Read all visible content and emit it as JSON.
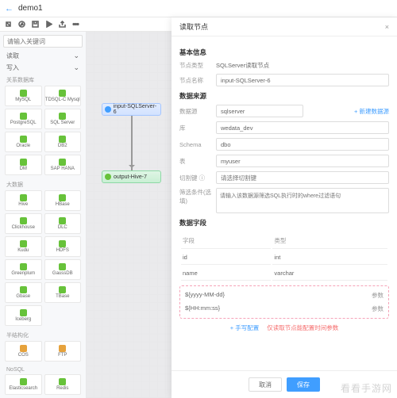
{
  "header": {
    "title": "demo1"
  },
  "search": {
    "placeholder": "请输入关键词"
  },
  "accordion": {
    "read": "读取",
    "write": "写入"
  },
  "groups": [
    {
      "label": "关系数据库",
      "items": [
        {
          "name": "MySQL",
          "c": "g"
        },
        {
          "name": "TDSQL-C Mysql",
          "c": "g"
        },
        {
          "name": "PostgreSQL",
          "c": "g"
        },
        {
          "name": "SQL Server",
          "c": "g"
        },
        {
          "name": "Oracle",
          "c": "g"
        },
        {
          "name": "DB2",
          "c": "g"
        },
        {
          "name": "DM",
          "c": "g"
        },
        {
          "name": "SAP HANA",
          "c": "g"
        }
      ]
    },
    {
      "label": "大数据",
      "items": [
        {
          "name": "Hive",
          "c": "g"
        },
        {
          "name": "HBase",
          "c": "g"
        },
        {
          "name": "Clickhouse",
          "c": "g"
        },
        {
          "name": "DLC",
          "c": "g"
        },
        {
          "name": "Kudu",
          "c": "g"
        },
        {
          "name": "HDFS",
          "c": "g"
        },
        {
          "name": "Greenplum",
          "c": "g"
        },
        {
          "name": "GaussDB",
          "c": "g"
        },
        {
          "name": "Gbase",
          "c": "g"
        },
        {
          "name": "TBase",
          "c": "g"
        },
        {
          "name": "Iceberg",
          "c": "g"
        }
      ]
    },
    {
      "label": "半结构化",
      "items": [
        {
          "name": "COS",
          "c": "o"
        },
        {
          "name": "FTP",
          "c": "o"
        }
      ]
    },
    {
      "label": "NoSQL",
      "items": [
        {
          "name": "Elasticsearch",
          "c": "g"
        },
        {
          "name": "Redis",
          "c": "g"
        }
      ]
    }
  ],
  "canvas": {
    "nodeIn": "input-SQLServer-6",
    "nodeOut": "output-Hive-7"
  },
  "panel": {
    "title": "读取节点",
    "basic": {
      "section": "基本信息",
      "typeLabel": "节点类型",
      "typeValue": "SQLServer读取节点",
      "nameLabel": "节点名称",
      "nameValue": "input-SQLServer-6"
    },
    "source": {
      "section": "数据来源",
      "srcLabel": "数据源",
      "srcValue": "sqlserver",
      "newLink": "+ 新建数据源",
      "dbLabel": "库",
      "dbValue": "wedata_dev",
      "schLabel": "Schema",
      "schValue": "dbo",
      "tblLabel": "表",
      "tblValue": "myuser",
      "splitLabel": "切割键 ⓘ",
      "splitPlaceholder": "请选择切割键",
      "condLabel": "筛选条件(选填)",
      "condPlaceholder": "请输入该数据源筛选SQL执行时的where过滤语句"
    },
    "fields": {
      "section": "数据字段",
      "colField": "字段",
      "colType": "类型",
      "rows": [
        {
          "f": "id",
          "t": "int"
        },
        {
          "f": "name",
          "t": "varchar"
        }
      ],
      "params": [
        {
          "f": "${yyyy-MM-dd}",
          "t": "参数"
        },
        {
          "f": "${HH:mm:ss}",
          "t": "参数"
        }
      ],
      "addField": "+ 手写配置",
      "restore": "仅读取节点能配置时间参数"
    },
    "btnCancel": "取消",
    "btnSave": "保存"
  },
  "watermark": "看看手游网"
}
